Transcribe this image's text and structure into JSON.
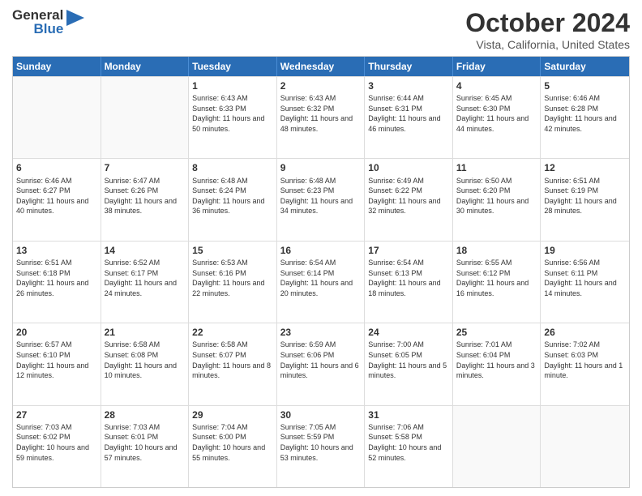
{
  "logo": {
    "general": "General",
    "blue": "Blue"
  },
  "title": "October 2024",
  "location": "Vista, California, United States",
  "days": [
    "Sunday",
    "Monday",
    "Tuesday",
    "Wednesday",
    "Thursday",
    "Friday",
    "Saturday"
  ],
  "weeks": [
    [
      {
        "day": "",
        "empty": true
      },
      {
        "day": "",
        "empty": true
      },
      {
        "day": "1",
        "line1": "Sunrise: 6:43 AM",
        "line2": "Sunset: 6:33 PM",
        "line3": "Daylight: 11 hours and 50 minutes."
      },
      {
        "day": "2",
        "line1": "Sunrise: 6:43 AM",
        "line2": "Sunset: 6:32 PM",
        "line3": "Daylight: 11 hours and 48 minutes."
      },
      {
        "day": "3",
        "line1": "Sunrise: 6:44 AM",
        "line2": "Sunset: 6:31 PM",
        "line3": "Daylight: 11 hours and 46 minutes."
      },
      {
        "day": "4",
        "line1": "Sunrise: 6:45 AM",
        "line2": "Sunset: 6:30 PM",
        "line3": "Daylight: 11 hours and 44 minutes."
      },
      {
        "day": "5",
        "line1": "Sunrise: 6:46 AM",
        "line2": "Sunset: 6:28 PM",
        "line3": "Daylight: 11 hours and 42 minutes."
      }
    ],
    [
      {
        "day": "6",
        "line1": "Sunrise: 6:46 AM",
        "line2": "Sunset: 6:27 PM",
        "line3": "Daylight: 11 hours and 40 minutes."
      },
      {
        "day": "7",
        "line1": "Sunrise: 6:47 AM",
        "line2": "Sunset: 6:26 PM",
        "line3": "Daylight: 11 hours and 38 minutes."
      },
      {
        "day": "8",
        "line1": "Sunrise: 6:48 AM",
        "line2": "Sunset: 6:24 PM",
        "line3": "Daylight: 11 hours and 36 minutes."
      },
      {
        "day": "9",
        "line1": "Sunrise: 6:48 AM",
        "line2": "Sunset: 6:23 PM",
        "line3": "Daylight: 11 hours and 34 minutes."
      },
      {
        "day": "10",
        "line1": "Sunrise: 6:49 AM",
        "line2": "Sunset: 6:22 PM",
        "line3": "Daylight: 11 hours and 32 minutes."
      },
      {
        "day": "11",
        "line1": "Sunrise: 6:50 AM",
        "line2": "Sunset: 6:20 PM",
        "line3": "Daylight: 11 hours and 30 minutes."
      },
      {
        "day": "12",
        "line1": "Sunrise: 6:51 AM",
        "line2": "Sunset: 6:19 PM",
        "line3": "Daylight: 11 hours and 28 minutes."
      }
    ],
    [
      {
        "day": "13",
        "line1": "Sunrise: 6:51 AM",
        "line2": "Sunset: 6:18 PM",
        "line3": "Daylight: 11 hours and 26 minutes."
      },
      {
        "day": "14",
        "line1": "Sunrise: 6:52 AM",
        "line2": "Sunset: 6:17 PM",
        "line3": "Daylight: 11 hours and 24 minutes."
      },
      {
        "day": "15",
        "line1": "Sunrise: 6:53 AM",
        "line2": "Sunset: 6:16 PM",
        "line3": "Daylight: 11 hours and 22 minutes."
      },
      {
        "day": "16",
        "line1": "Sunrise: 6:54 AM",
        "line2": "Sunset: 6:14 PM",
        "line3": "Daylight: 11 hours and 20 minutes."
      },
      {
        "day": "17",
        "line1": "Sunrise: 6:54 AM",
        "line2": "Sunset: 6:13 PM",
        "line3": "Daylight: 11 hours and 18 minutes."
      },
      {
        "day": "18",
        "line1": "Sunrise: 6:55 AM",
        "line2": "Sunset: 6:12 PM",
        "line3": "Daylight: 11 hours and 16 minutes."
      },
      {
        "day": "19",
        "line1": "Sunrise: 6:56 AM",
        "line2": "Sunset: 6:11 PM",
        "line3": "Daylight: 11 hours and 14 minutes."
      }
    ],
    [
      {
        "day": "20",
        "line1": "Sunrise: 6:57 AM",
        "line2": "Sunset: 6:10 PM",
        "line3": "Daylight: 11 hours and 12 minutes."
      },
      {
        "day": "21",
        "line1": "Sunrise: 6:58 AM",
        "line2": "Sunset: 6:08 PM",
        "line3": "Daylight: 11 hours and 10 minutes."
      },
      {
        "day": "22",
        "line1": "Sunrise: 6:58 AM",
        "line2": "Sunset: 6:07 PM",
        "line3": "Daylight: 11 hours and 8 minutes."
      },
      {
        "day": "23",
        "line1": "Sunrise: 6:59 AM",
        "line2": "Sunset: 6:06 PM",
        "line3": "Daylight: 11 hours and 6 minutes."
      },
      {
        "day": "24",
        "line1": "Sunrise: 7:00 AM",
        "line2": "Sunset: 6:05 PM",
        "line3": "Daylight: 11 hours and 5 minutes."
      },
      {
        "day": "25",
        "line1": "Sunrise: 7:01 AM",
        "line2": "Sunset: 6:04 PM",
        "line3": "Daylight: 11 hours and 3 minutes."
      },
      {
        "day": "26",
        "line1": "Sunrise: 7:02 AM",
        "line2": "Sunset: 6:03 PM",
        "line3": "Daylight: 11 hours and 1 minute."
      }
    ],
    [
      {
        "day": "27",
        "line1": "Sunrise: 7:03 AM",
        "line2": "Sunset: 6:02 PM",
        "line3": "Daylight: 10 hours and 59 minutes."
      },
      {
        "day": "28",
        "line1": "Sunrise: 7:03 AM",
        "line2": "Sunset: 6:01 PM",
        "line3": "Daylight: 10 hours and 57 minutes."
      },
      {
        "day": "29",
        "line1": "Sunrise: 7:04 AM",
        "line2": "Sunset: 6:00 PM",
        "line3": "Daylight: 10 hours and 55 minutes."
      },
      {
        "day": "30",
        "line1": "Sunrise: 7:05 AM",
        "line2": "Sunset: 5:59 PM",
        "line3": "Daylight: 10 hours and 53 minutes."
      },
      {
        "day": "31",
        "line1": "Sunrise: 7:06 AM",
        "line2": "Sunset: 5:58 PM",
        "line3": "Daylight: 10 hours and 52 minutes."
      },
      {
        "day": "",
        "empty": true
      },
      {
        "day": "",
        "empty": true
      }
    ]
  ]
}
